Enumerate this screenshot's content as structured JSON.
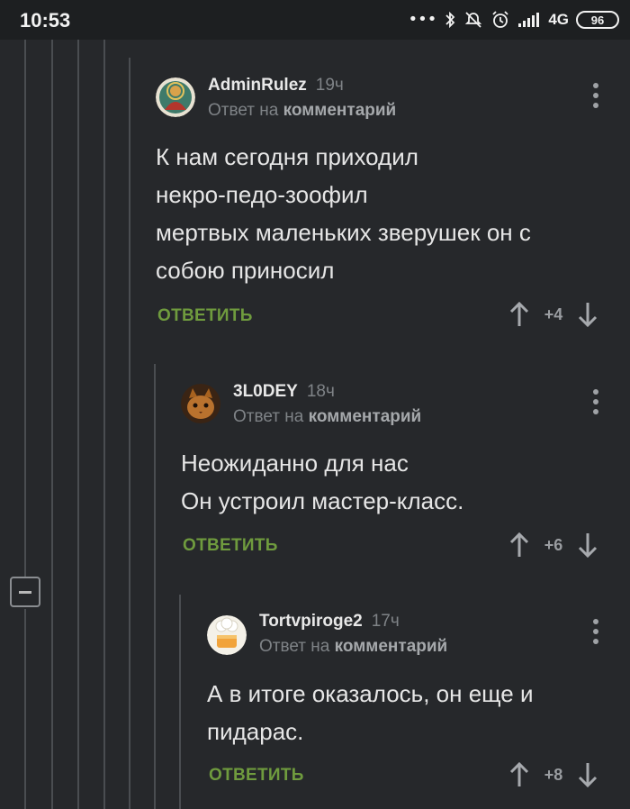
{
  "status_bar": {
    "time": "10:53",
    "signal_dots": "•••",
    "network": "4G",
    "battery": "96",
    "icons": [
      "bluetooth-icon",
      "mute-icon",
      "alarm-icon",
      "signal-icon",
      "battery-icon"
    ]
  },
  "colors": {
    "background": "#26282b",
    "reply_link": "#6f9b3e",
    "muted_text": "#7f8387",
    "guide_line": "#4a4d51"
  },
  "comments": [
    {
      "username": "AdminRulez",
      "time": "19ч",
      "reply_prefix": "Ответ на",
      "reply_target": "комментарий",
      "text": "К нам сегодня приходил\nнекро-педо-зоофил\nмертвых маленьких зверушек он с\nсобою приносил",
      "reply_label": "ОТВЕТИТЬ",
      "score": "+4",
      "avatar": "buddha-avatar"
    },
    {
      "username": "3L0DEY",
      "time": "18ч",
      "reply_prefix": "Ответ на",
      "reply_target": "комментарий",
      "text": "Неожиданно для нас\nОн устроил мастер-класс.",
      "reply_label": "ОТВЕТИТЬ",
      "score": "+6",
      "avatar": "cat-avatar"
    },
    {
      "username": "Tortvpiroge2",
      "time": "17ч",
      "reply_prefix": "Ответ на",
      "reply_target": "комментарий",
      "text": "А в итоге оказалось, он еще и\nпидарас.",
      "reply_label": "ОТВЕТИТЬ",
      "score": "+8",
      "avatar": "chef-avatar"
    }
  ]
}
